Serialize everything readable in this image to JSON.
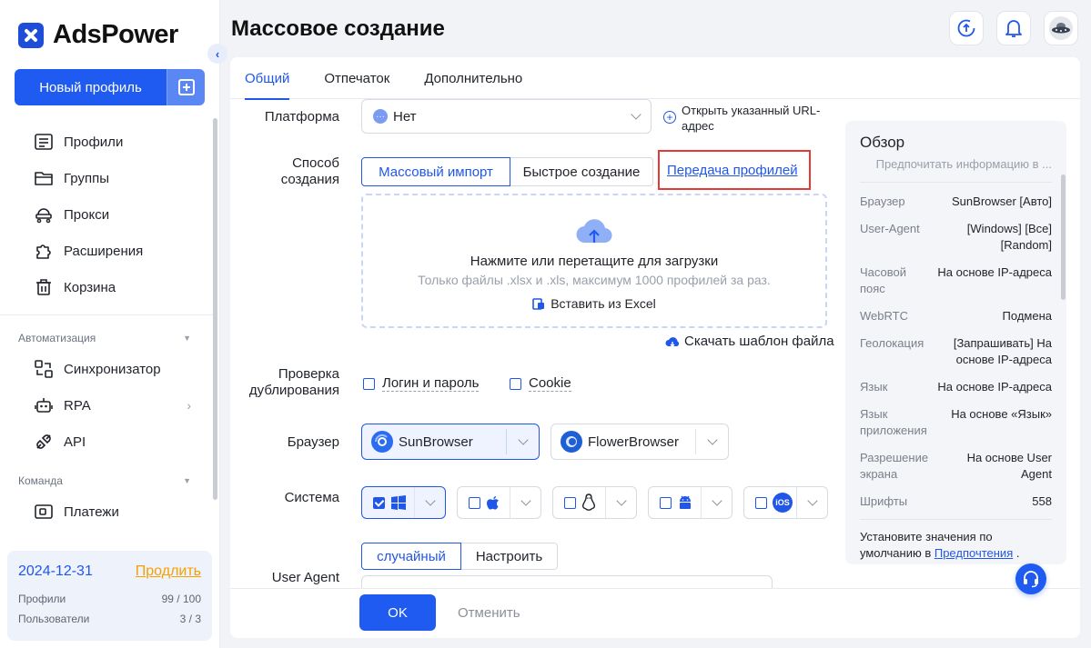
{
  "brand": {
    "name": "AdsPower"
  },
  "sidebar": {
    "new_profile_label": "Новый профиль",
    "items": [
      {
        "label": "Профили",
        "icon": "profiles-icon"
      },
      {
        "label": "Группы",
        "icon": "folder-icon"
      },
      {
        "label": "Прокси",
        "icon": "proxy-icon"
      },
      {
        "label": "Расширения",
        "icon": "puzzle-icon"
      },
      {
        "label": "Корзина",
        "icon": "trash-icon"
      }
    ],
    "automation_title": "Автоматизация",
    "automation_items": [
      {
        "label": "Синхронизатор",
        "icon": "sync-icon"
      },
      {
        "label": "RPA",
        "icon": "robot-icon"
      },
      {
        "label": "API",
        "icon": "api-icon"
      }
    ],
    "team_title": "Команда",
    "team_items": [
      {
        "label": "Платежи",
        "icon": "payment-icon"
      }
    ]
  },
  "account": {
    "expiry": "2024-12-31",
    "renew_label": "Продлить",
    "profiles_label": "Профили",
    "profiles_value": "99 / 100",
    "users_label": "Пользователи",
    "users_value": "3 / 3"
  },
  "header": {
    "title": "Массовое создание"
  },
  "tabs": [
    {
      "label": "Общий",
      "active": true
    },
    {
      "label": "Отпечаток",
      "active": false
    },
    {
      "label": "Дополнительно",
      "active": false
    }
  ],
  "form": {
    "platform": {
      "label": "Платформа",
      "value": "Нет",
      "open_url_label": "Открыть указанный URL-адрес"
    },
    "creation": {
      "label": "Способ создания",
      "options": [
        "Массовый импорт",
        "Быстрое создание"
      ],
      "transfer_link": "Передача профилей"
    },
    "upload": {
      "title": "Нажмите или перетащите для загрузки",
      "hint": "Только файлы .xlsx и .xls, максимум 1000 профилей за раз.",
      "paste_label": "Вставить из Excel",
      "template_label": "Скачать шаблон файла"
    },
    "duplicate": {
      "label": "Проверка дублирования",
      "options": [
        "Логин и пароль",
        "Cookie"
      ]
    },
    "browser": {
      "label": "Браузер",
      "options": [
        "SunBrowser",
        "FlowerBrowser"
      ]
    },
    "system": {
      "label": "Система"
    },
    "user_agent": {
      "label": "User Agent",
      "options": [
        "случайный",
        "Настроить"
      ]
    }
  },
  "footer": {
    "ok_label": "OK",
    "cancel_label": "Отменить"
  },
  "overview": {
    "title": "Обзор",
    "subtitle": "Предпочитать информацию в ...",
    "rows": [
      {
        "k": "Браузер",
        "v": "SunBrowser [Авто]"
      },
      {
        "k": "User-Agent",
        "v": "[Windows] [Все] [Random]"
      },
      {
        "k": "Часовой пояс",
        "v": "На основе IP-адреса"
      },
      {
        "k": "WebRTC",
        "v": "Подмена"
      },
      {
        "k": "Геолокация",
        "v": "[Запрашивать] На основе IP-адреса"
      },
      {
        "k": "Язык",
        "v": "На основе IP-адреса"
      },
      {
        "k": "Язык приложения",
        "v": "На основе «Язык»"
      },
      {
        "k": "Разрешение экрана",
        "v": "На основе User Agent"
      },
      {
        "k": "Шрифты",
        "v": "558"
      }
    ],
    "note_prefix": "Установите значения по умолчанию в ",
    "note_link": "Предпочтения",
    "note_suffix": " ."
  },
  "colors": {
    "accent": "#1f5bf0",
    "highlight_border": "#e53935",
    "renew": "#f5a000"
  }
}
